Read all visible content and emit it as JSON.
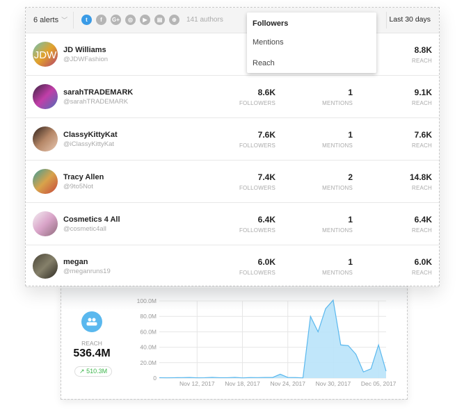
{
  "header": {
    "alerts_label": "6 alerts",
    "authors_label": "141 authors",
    "date_range": "Last 30 days",
    "networks": [
      {
        "icon": "twitter-icon",
        "glyph": "t",
        "active": true
      },
      {
        "icon": "facebook-icon",
        "glyph": "f"
      },
      {
        "icon": "google-plus-icon",
        "glyph": "G+"
      },
      {
        "icon": "instagram-icon",
        "glyph": "◎"
      },
      {
        "icon": "youtube-icon",
        "glyph": "▶"
      },
      {
        "icon": "news-icon",
        "glyph": "▤"
      },
      {
        "icon": "web-icon",
        "glyph": "⊕"
      }
    ]
  },
  "sort_menu": {
    "items": [
      "Followers",
      "Mentions",
      "Reach"
    ],
    "selected": "Followers"
  },
  "labels": {
    "followers": "FOLLOWERS",
    "mentions": "MENTIONS",
    "reach": "REACH"
  },
  "authors": [
    {
      "name": "JD Williams",
      "handle": "@JDWFashion",
      "followers": "",
      "mentions": "",
      "reach": "8.8K",
      "avatar_colors": [
        "#6bc3b8",
        "#e2a22b",
        "#b3416d"
      ],
      "avatar_text": "JDW"
    },
    {
      "name": "sarahTRADEMARK",
      "handle": "@sarahTRADEMARK",
      "followers": "8.6K",
      "mentions": "1",
      "reach": "9.1K",
      "avatar_colors": [
        "#3a2340",
        "#c13ea8",
        "#4c6fb8"
      ]
    },
    {
      "name": "ClassyKittyKat",
      "handle": "@iClassyKittyKat",
      "followers": "7.6K",
      "mentions": "1",
      "reach": "7.6K",
      "avatar_colors": [
        "#2b1d18",
        "#b58767",
        "#e8c7b0"
      ]
    },
    {
      "name": "Tracy Allen",
      "handle": "@9to5Not",
      "followers": "7.4K",
      "mentions": "2",
      "reach": "14.8K",
      "avatar_colors": [
        "#3a9c9a",
        "#d8a34b",
        "#c6473b"
      ]
    },
    {
      "name": "Cosmetics 4 All",
      "handle": "@cosmetic4all",
      "followers": "6.4K",
      "mentions": "1",
      "reach": "6.4K",
      "avatar_colors": [
        "#f4eef2",
        "#d9a4c8",
        "#8f6b7d"
      ]
    },
    {
      "name": "megan",
      "handle": "@meganruns19",
      "followers": "6.0K",
      "mentions": "1",
      "reach": "6.0K",
      "avatar_colors": [
        "#4a4638",
        "#85806a",
        "#2d2a22"
      ]
    }
  ],
  "summary": {
    "label": "REACH",
    "value": "536.4M",
    "change": "510.3M",
    "accent": "#5ab8ee",
    "change_color": "#3bb54a"
  },
  "chart_data": {
    "type": "area",
    "color": "#5ab8ee",
    "fill": "#b9e3fa",
    "grid": true,
    "ylim": [
      0,
      100
    ],
    "yticks": [
      {
        "v": 0,
        "label": "0"
      },
      {
        "v": 20,
        "label": "20.0M"
      },
      {
        "v": 40,
        "label": "40.0M"
      },
      {
        "v": 60,
        "label": "60.0M"
      },
      {
        "v": 80,
        "label": "80.0M"
      },
      {
        "v": 100,
        "label": "100.0M"
      }
    ],
    "x": [
      "Nov 07",
      "Nov 08",
      "Nov 09",
      "Nov 10",
      "Nov 11",
      "Nov 12",
      "Nov 13",
      "Nov 14",
      "Nov 15",
      "Nov 16",
      "Nov 17",
      "Nov 18",
      "Nov 19",
      "Nov 20",
      "Nov 21",
      "Nov 22",
      "Nov 23",
      "Nov 24",
      "Nov 25",
      "Nov 26",
      "Nov 27",
      "Nov 28",
      "Nov 29",
      "Nov 30",
      "Dec 01",
      "Dec 02",
      "Dec 03",
      "Dec 04",
      "Dec 05",
      "Dec 06",
      "Dec 07"
    ],
    "values": [
      0.5,
      0.4,
      0.5,
      0.6,
      0.8,
      0.4,
      0.5,
      0.9,
      0.5,
      0.5,
      0.9,
      0.3,
      0.7,
      0.6,
      0.8,
      0.8,
      5,
      0.8,
      0.7,
      0.3,
      80,
      60,
      90,
      101,
      43,
      42,
      31,
      8,
      12,
      43,
      9
    ],
    "xticks": [
      {
        "i": 5,
        "label": "Nov 12, 2017"
      },
      {
        "i": 11,
        "label": "Nov 18, 2017"
      },
      {
        "i": 17,
        "label": "Nov 24, 2017"
      },
      {
        "i": 23,
        "label": "Nov 30, 2017"
      },
      {
        "i": 29,
        "label": "Dec 05, 2017"
      }
    ]
  }
}
